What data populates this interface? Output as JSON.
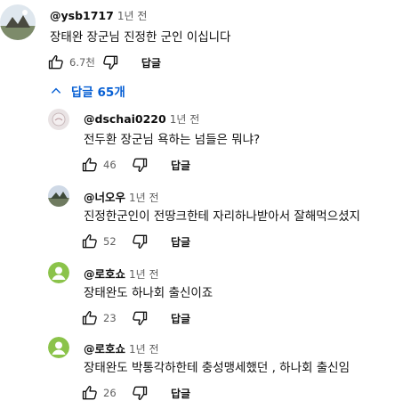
{
  "top_comment": {
    "author": "@ysb1717",
    "time": "1년 전",
    "text": "장태완 장군님 진정한 군인 이십니다",
    "likes": "6.7천",
    "reply_label": "답글"
  },
  "replies_toggle": {
    "label": "답글 65개"
  },
  "replies": [
    {
      "author": "@dschai0220",
      "time": "1년 전",
      "text": "전두환 장군님 욕하는 넘들은 뭐냐?",
      "likes": "46",
      "reply_label": "답글"
    },
    {
      "author": "@너오우",
      "time": "1년 전",
      "text": "진정한군인이 전땅크한테 자리하나받아서 잘해먹으셨지",
      "likes": "52",
      "reply_label": "답글"
    },
    {
      "author": "@로호쇼",
      "time": "1년 전",
      "text": "장태완도  하나회  출신이죠",
      "likes": "23",
      "reply_label": "답글"
    },
    {
      "author": "@로호쇼",
      "time": "1년 전",
      "text": "장태완도  박통각하한테  충성맹세했던 ,  하나회 출신임",
      "likes": "26",
      "reply_label": "답글"
    }
  ],
  "icons": {
    "like": "thumbs-up-icon",
    "dislike": "thumbs-down-icon",
    "collapse": "chevron-up-icon",
    "default_avatar": "person-icon"
  },
  "colors": {
    "link_blue": "#065fd4",
    "default_avatar_green": "#8bc34a"
  }
}
